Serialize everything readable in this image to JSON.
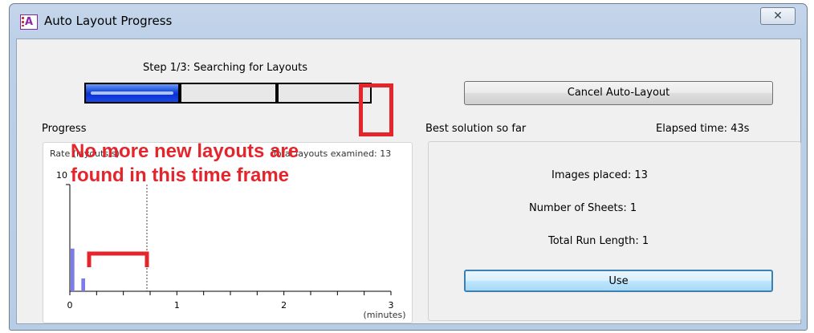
{
  "window": {
    "title": "Auto Layout Progress",
    "app_icon_text": "A",
    "close_glyph": "✕"
  },
  "step": {
    "label": "Step 1/3: Searching for Layouts",
    "current": 1,
    "total": 3
  },
  "cancel_label": "Cancel Auto-Layout",
  "progress": {
    "heading": "Progress",
    "rate_label": "Rate (layouts/s)",
    "total_label": "Total layouts examined: 13",
    "y_max_label": "10",
    "x_unit_label": "(minutes)"
  },
  "chart_data": {
    "type": "bar",
    "ylabel": "Rate (layouts/s)",
    "xlabel": "(minutes)",
    "xlim": [
      0,
      3
    ],
    "ylim": [
      0,
      10
    ],
    "x_ticks": [
      "0",
      "1",
      "2",
      "3"
    ],
    "x_minor_step": 0.25,
    "current_time_marker": 0.72,
    "bar_color": "#7b7bea",
    "x": [
      0.025,
      0.125
    ],
    "values": [
      4.0,
      1.2
    ],
    "bar_width": 0.035
  },
  "best": {
    "heading": "Best solution so far",
    "elapsed": "Elapsed time: 43s",
    "images_placed": "Images placed:  13",
    "sheets": "Number of Sheets:  1",
    "run_length": "Total Run Length:  1",
    "use_label": "Use"
  },
  "annotation": {
    "text_line1": "No more new layouts are",
    "text_line2": "found in this time frame",
    "color": "#e5252c"
  }
}
